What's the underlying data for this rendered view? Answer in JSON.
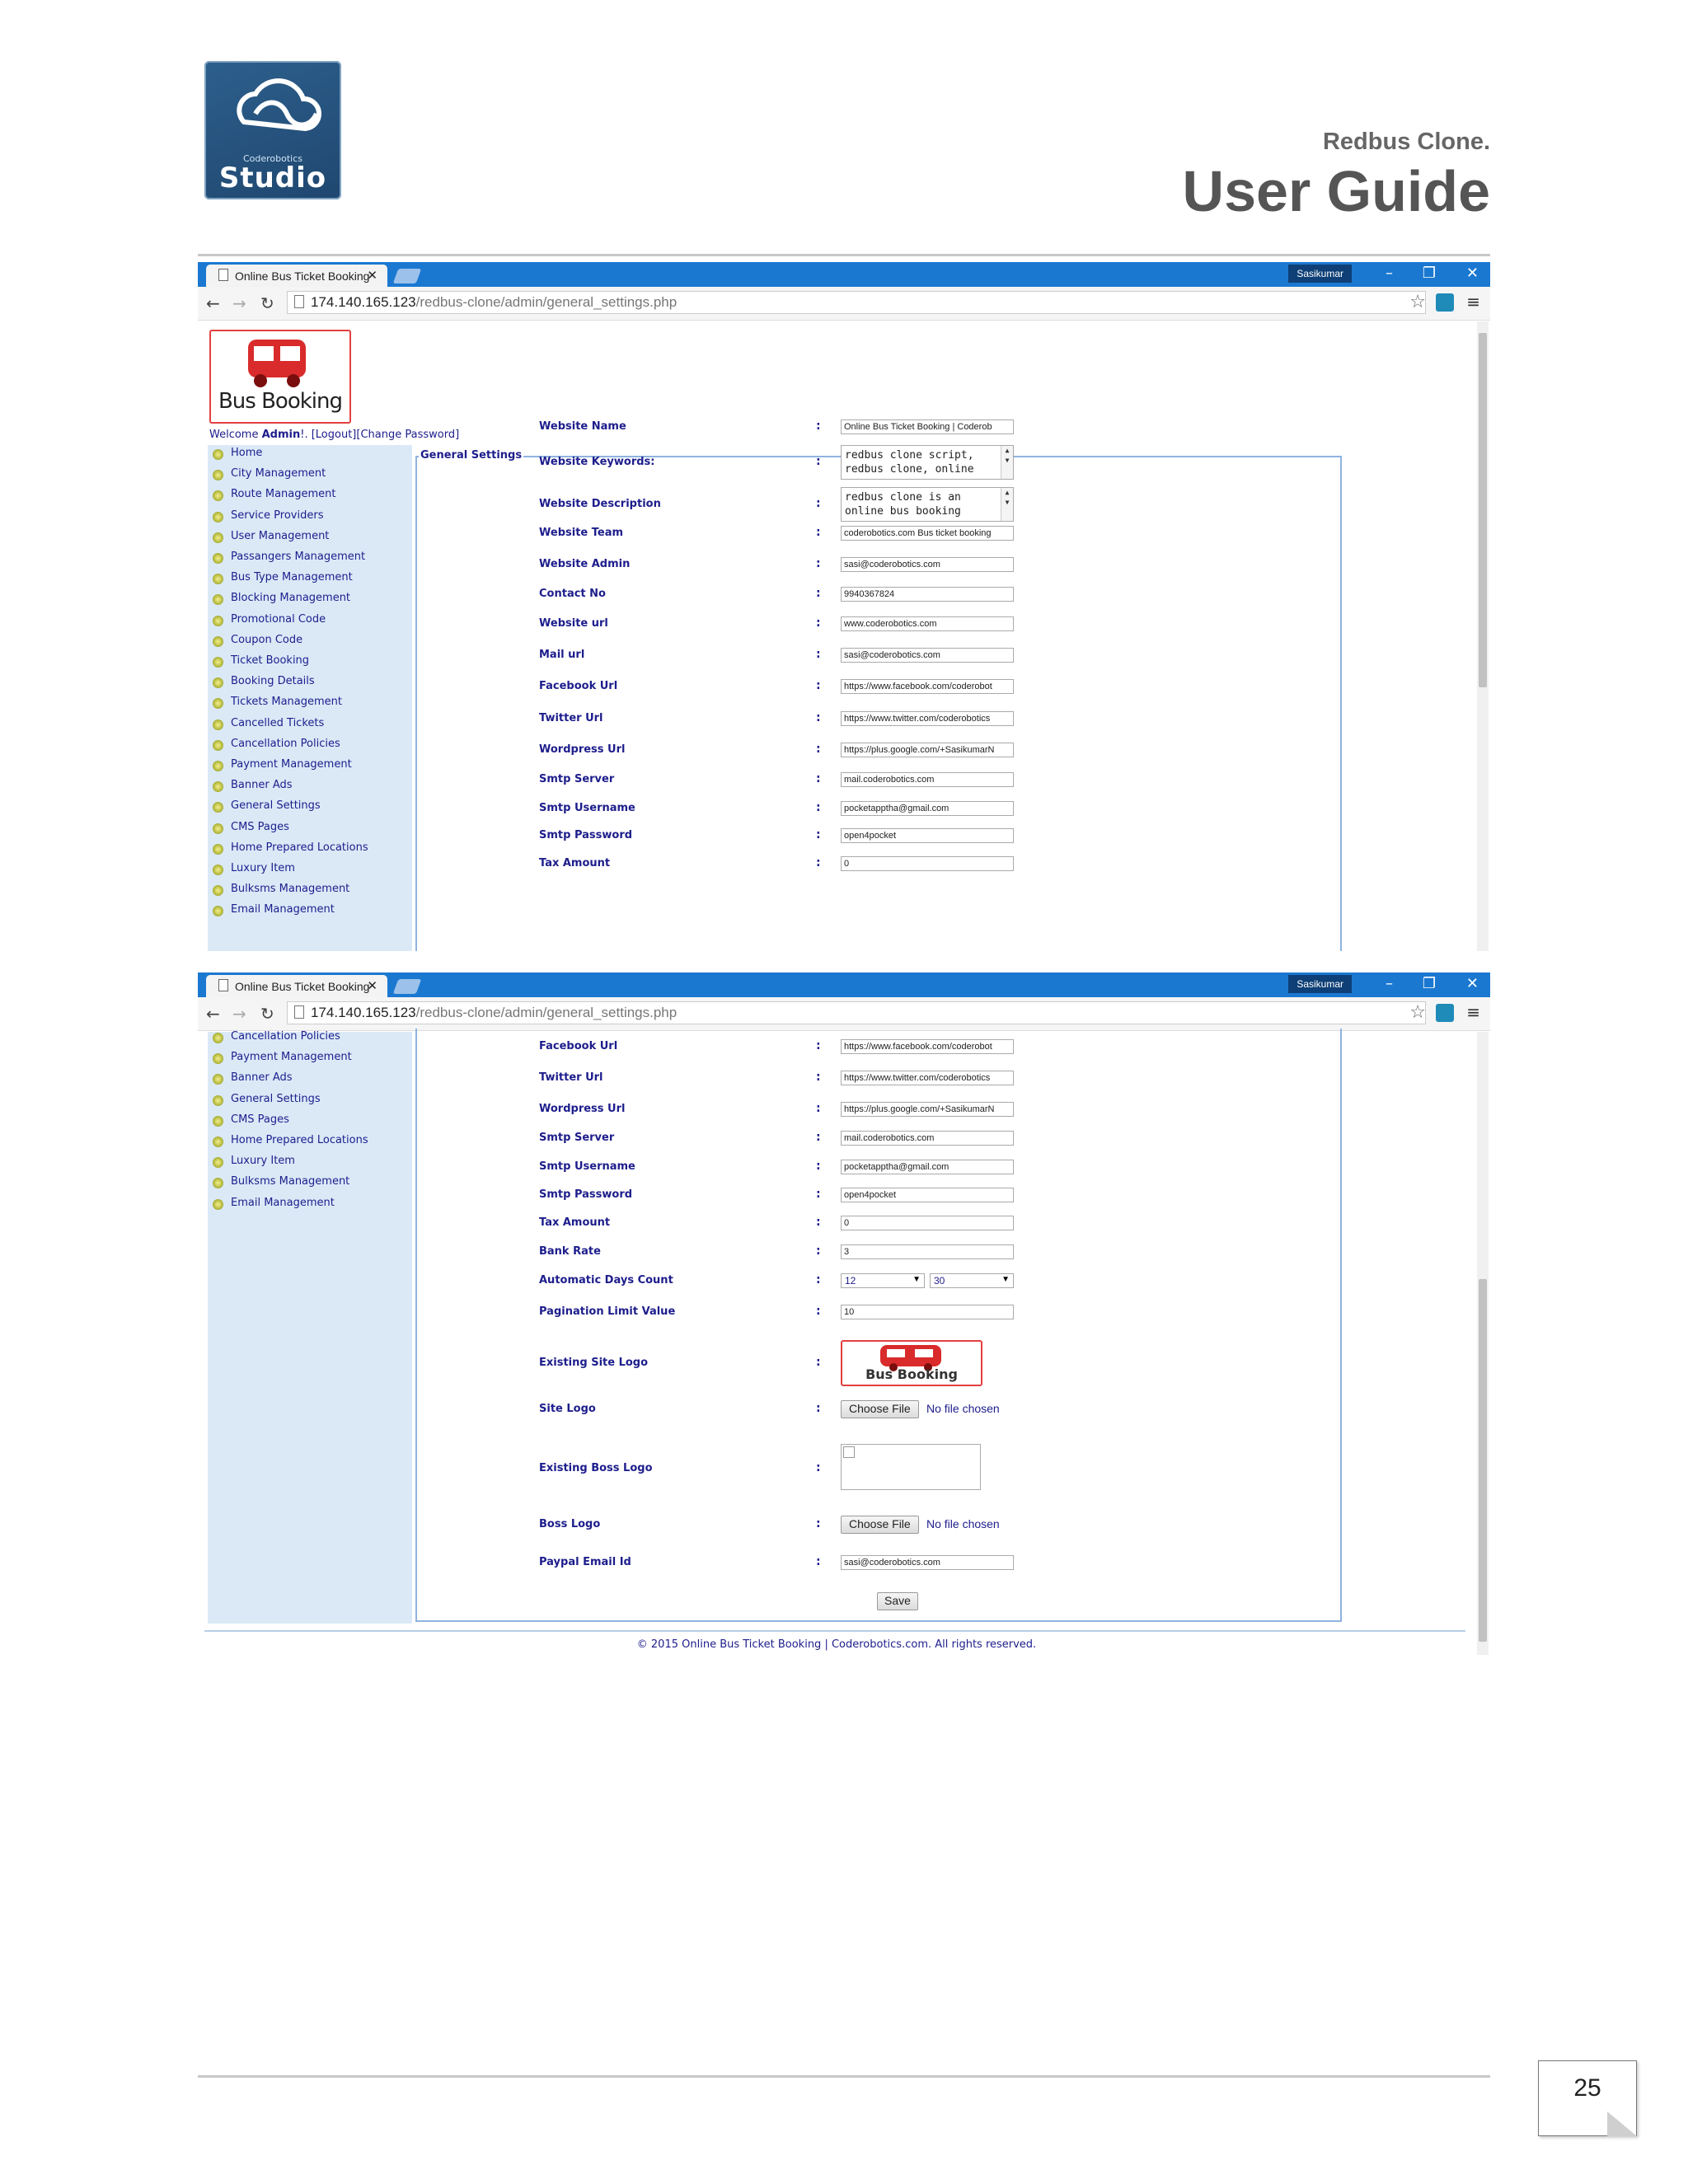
{
  "doc": {
    "logo": {
      "company": "Coderobotics",
      "studio": "Studio"
    },
    "subtitle": "Redbus Clone.",
    "title": "User Guide",
    "page_number": "25"
  },
  "browser": {
    "tab_title": "Online Bus Ticket Booking",
    "user": "Sasikumar",
    "url_host": "174.140.165.123",
    "url_path": "/redbus-clone/admin/general_settings.php"
  },
  "admin": {
    "logo_text": "Bus Booking",
    "welcome": "Welcome ",
    "username": "Admin",
    "welcome_suffix": "!. ",
    "logout": "[Logout]",
    "change_password": "[Change Password]",
    "legend": "General Settings"
  },
  "sidebar_items": [
    "Home",
    "City Management",
    "Route Management",
    "Service Providers",
    "User Management",
    "Passangers Management",
    "Bus Type Management",
    "Blocking Management",
    "Promotional Code",
    "Coupon Code",
    "Ticket Booking",
    "Booking Details",
    "Tickets Management",
    "Cancelled Tickets",
    "Cancellation Policies",
    "Payment Management",
    "Banner Ads",
    "General Settings",
    "CMS Pages",
    "Home Prepared Locations",
    "Luxury Item",
    "Bulksms Management",
    "Email Management"
  ],
  "sidebar_items_second": [
    "Cancellation Policies",
    "Payment Management",
    "Banner Ads",
    "General Settings",
    "CMS Pages",
    "Home Prepared Locations",
    "Luxury Item",
    "Bulksms Management",
    "Email Management"
  ],
  "fields_first": [
    {
      "label": "Website Name",
      "value": "Online Bus Ticket Booking | Coderob"
    },
    {
      "label": "Website Keywords:",
      "value": "redbus clone script,\nredbus clone, online"
    },
    {
      "label": "Website Description",
      "value": "redbus clone is an\nonline bus booking"
    },
    {
      "label": "Website Team",
      "value": "coderobotics.com Bus ticket booking"
    },
    {
      "label": "Website Admin",
      "value": "sasi@coderobotics.com"
    },
    {
      "label": "Contact No",
      "value": "9940367824"
    },
    {
      "label": "Website url",
      "value": "www.coderobotics.com"
    },
    {
      "label": "Mail url",
      "value": "sasi@coderobotics.com"
    },
    {
      "label": "Facebook Url",
      "value": "https://www.facebook.com/coderobot"
    },
    {
      "label": "Twitter Url",
      "value": "https://www.twitter.com/coderobotics"
    },
    {
      "label": "Wordpress Url",
      "value": "https://plus.google.com/+SasikumarN"
    },
    {
      "label": "Smtp Server",
      "value": "mail.coderobotics.com"
    },
    {
      "label": "Smtp Username",
      "value": "pocketapptha@gmail.com"
    },
    {
      "label": "Smtp Password",
      "value": "open4pocket"
    },
    {
      "label": "Tax Amount",
      "value": "0"
    }
  ],
  "fields_second": [
    {
      "label": "Facebook Url",
      "value": "https://www.facebook.com/coderobot"
    },
    {
      "label": "Twitter Url",
      "value": "https://www.twitter.com/coderobotics"
    },
    {
      "label": "Wordpress Url",
      "value": "https://plus.google.com/+SasikumarN"
    },
    {
      "label": "Smtp Server",
      "value": "mail.coderobotics.com"
    },
    {
      "label": "Smtp Username",
      "value": "pocketapptha@gmail.com"
    },
    {
      "label": "Smtp Password",
      "value": "open4pocket"
    },
    {
      "label": "Tax Amount",
      "value": "0"
    },
    {
      "label": "Bank Rate",
      "value": "3"
    },
    {
      "label": "Automatic Days Count",
      "select1": "12",
      "select2": "30"
    },
    {
      "label": "Pagination Limit Value",
      "value": "10"
    },
    {
      "label": "Existing Site Logo"
    },
    {
      "label": "Site Logo",
      "button": "Choose File",
      "status": "No file chosen"
    },
    {
      "label": "Existing Boss Logo"
    },
    {
      "label": "Boss Logo",
      "button": "Choose File",
      "status": "No file chosen"
    },
    {
      "label": "Paypal Email Id",
      "value": "sasi@coderobotics.com"
    }
  ],
  "colon": ":",
  "save_label": "Save",
  "footer": "© 2015 Online Bus Ticket Booking | Coderobotics.com. All rights reserved.",
  "colors": {
    "titlebar": "#1a78d1",
    "sidebar": "#dbe9f7",
    "link": "#1d1d8c",
    "logo_border": "#e34040"
  }
}
